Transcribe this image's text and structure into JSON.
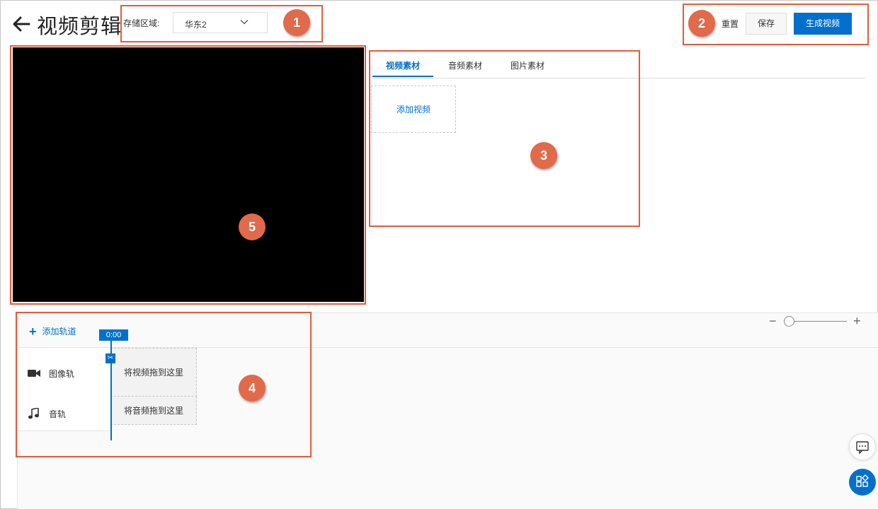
{
  "header": {
    "title": "视频剪辑",
    "region_label": "存储区域:",
    "region_value": "华东2",
    "reset_label": "重置",
    "save_label": "保存",
    "generate_label": "生成视频"
  },
  "materials": {
    "tabs": [
      {
        "label": "视频素材",
        "active": true
      },
      {
        "label": "音频素材",
        "active": false
      },
      {
        "label": "图片素材",
        "active": false
      }
    ],
    "add_video_label": "添加视频"
  },
  "timeline": {
    "add_track_label": "添加轨道",
    "current_time": "0:00",
    "tracks": [
      {
        "icon": "video-camera-icon",
        "label": "图像轨",
        "drop_hint": "将视频拖到这里"
      },
      {
        "icon": "music-note-icon",
        "label": "音轨",
        "drop_hint": "将音频拖到这里"
      }
    ]
  },
  "annotations": [
    "1",
    "2",
    "3",
    "4",
    "5"
  ],
  "colors": {
    "accent": "#0070cc",
    "annotation": "#e85a3a",
    "badge": "#e06a4a",
    "preview": "#000000"
  }
}
